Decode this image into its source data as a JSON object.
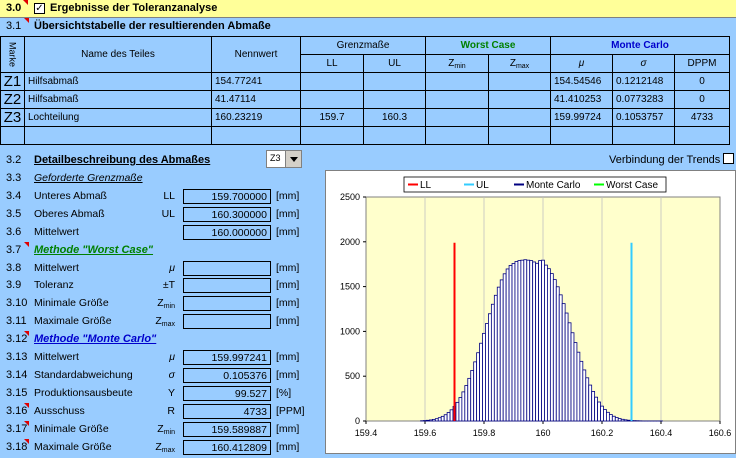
{
  "header": {
    "section_no": "3.0",
    "title": "Ergebnisse der Toleranzanalyse",
    "checked": "✓"
  },
  "overview": {
    "row_no": "3.1",
    "title": "Übersichtstabelle der resultierenden Abmaße"
  },
  "table": {
    "marker_header": "Marke",
    "name_header": "Name des Teiles",
    "nominal_header": "Nennwert",
    "limits_header": "Grenzmaße",
    "ll": "LL",
    "ul": "UL",
    "wc_header": "Worst Case",
    "zmin": "Z",
    "zmin_sub": "min",
    "zmax": "Z",
    "zmax_sub": "max",
    "mc_header": "Monte Carlo",
    "mu": "μ",
    "sigma": "σ",
    "dppm": "DPPM",
    "rows": [
      {
        "mark": "Z1",
        "name": "Hilfsabmaß",
        "nominal": "154.77241",
        "ll": "",
        "ul": "",
        "zmin": "",
        "zmax": "",
        "mu": "154.54546",
        "sigma": "0.1212148",
        "dppm": "0"
      },
      {
        "mark": "Z2",
        "name": "Hilfsabmaß",
        "nominal": "41.47114",
        "ll": "",
        "ul": "",
        "zmin": "",
        "zmax": "",
        "mu": "41.410253",
        "sigma": "0.0773283",
        "dppm": "0"
      },
      {
        "mark": "Z3",
        "name": "Lochteilung",
        "nominal": "160.23219",
        "ll": "159.7",
        "ul": "160.3",
        "zmin": "",
        "zmax": "",
        "mu": "159.99724",
        "sigma": "0.1053757",
        "dppm": "4733"
      }
    ]
  },
  "detail": {
    "row_no": "3.2",
    "title": "Detailbeschreibung des Abmaßes",
    "selector": "Z3",
    "trend_label": "Verbindung der Trends",
    "rows": [
      {
        "no": "3.3",
        "label": "Geforderte Grenzmaße",
        "type": "section"
      },
      {
        "no": "3.4",
        "label": "Unteres Abmaß",
        "sym": "LL",
        "value": "159.700000",
        "unit": "[mm]"
      },
      {
        "no": "3.5",
        "label": "Oberes Abmaß",
        "sym": "UL",
        "value": "160.300000",
        "unit": "[mm]"
      },
      {
        "no": "3.6",
        "label": "Mittelwert",
        "sym": "",
        "value": "160.000000",
        "unit": "[mm]"
      },
      {
        "no": "3.7",
        "label": "Methode \"Worst Case\"",
        "type": "wc"
      },
      {
        "no": "3.8",
        "label": "Mittelwert",
        "sym": "μ",
        "value": "",
        "unit": "[mm]"
      },
      {
        "no": "3.9",
        "label": "Toleranz",
        "sym": "±T",
        "value": "",
        "unit": "[mm]"
      },
      {
        "no": "3.10",
        "label": "Minimale Größe",
        "sym": "Z",
        "symsub": "min",
        "value": "",
        "unit": "[mm]"
      },
      {
        "no": "3.11",
        "label": "Maximale Größe",
        "sym": "Z",
        "symsub": "max",
        "value": "",
        "unit": "[mm]"
      },
      {
        "no": "3.12",
        "label": "Methode \"Monte Carlo\"",
        "type": "mc"
      },
      {
        "no": "3.13",
        "label": "Mittelwert",
        "sym": "μ",
        "value": "159.997241",
        "unit": "[mm]"
      },
      {
        "no": "3.14",
        "label": "Standardabweichung",
        "sym": "σ",
        "value": "0.105376",
        "unit": "[mm]"
      },
      {
        "no": "3.15",
        "label": "Produktionsausbeute",
        "sym": "Y",
        "value": "99.527",
        "unit": "[%]"
      },
      {
        "no": "3.16",
        "label": "Ausschuss",
        "sym": "R",
        "value": "4733",
        "unit": "[PPM]"
      },
      {
        "no": "3.17",
        "label": "Minimale Größe",
        "sym": "Z",
        "symsub": "min",
        "value": "159.589887",
        "unit": "[mm]"
      },
      {
        "no": "3.18",
        "label": "Maximale Größe",
        "sym": "Z",
        "symsub": "max",
        "value": "160.412809",
        "unit": "[mm]"
      }
    ]
  },
  "chart_data": {
    "type": "bar",
    "legend": [
      "LL",
      "UL",
      "Monte Carlo",
      "Worst Case"
    ],
    "legend_colors": [
      "#ff0000",
      "#33ccff",
      "#000080",
      "#00ff00"
    ],
    "xlim": [
      159.4,
      160.6
    ],
    "ylim": [
      0,
      2500
    ],
    "xticks": [
      159.4,
      159.6,
      159.8,
      160,
      160.2,
      160.4,
      160.6
    ],
    "yticks": [
      0,
      500,
      1000,
      1500,
      2000,
      2500
    ],
    "ll": 159.7,
    "ul": 160.3,
    "limit_line_height": 1990,
    "bin_width": 0.01,
    "bins": [
      {
        "x": 159.59,
        "y": 3
      },
      {
        "x": 159.6,
        "y": 5
      },
      {
        "x": 159.61,
        "y": 8
      },
      {
        "x": 159.62,
        "y": 12
      },
      {
        "x": 159.63,
        "y": 18
      },
      {
        "x": 159.64,
        "y": 26
      },
      {
        "x": 159.65,
        "y": 37
      },
      {
        "x": 159.66,
        "y": 52
      },
      {
        "x": 159.67,
        "y": 70
      },
      {
        "x": 159.68,
        "y": 95
      },
      {
        "x": 159.69,
        "y": 125
      },
      {
        "x": 159.7,
        "y": 163
      },
      {
        "x": 159.71,
        "y": 208
      },
      {
        "x": 159.72,
        "y": 262
      },
      {
        "x": 159.73,
        "y": 325
      },
      {
        "x": 159.74,
        "y": 396
      },
      {
        "x": 159.75,
        "y": 476
      },
      {
        "x": 159.76,
        "y": 564
      },
      {
        "x": 159.77,
        "y": 660
      },
      {
        "x": 159.78,
        "y": 762
      },
      {
        "x": 159.79,
        "y": 868
      },
      {
        "x": 159.8,
        "y": 978
      },
      {
        "x": 159.81,
        "y": 1088
      },
      {
        "x": 159.82,
        "y": 1197
      },
      {
        "x": 159.83,
        "y": 1303
      },
      {
        "x": 159.84,
        "y": 1403
      },
      {
        "x": 159.85,
        "y": 1494
      },
      {
        "x": 159.86,
        "y": 1575
      },
      {
        "x": 159.87,
        "y": 1643
      },
      {
        "x": 159.88,
        "y": 1697
      },
      {
        "x": 159.89,
        "y": 1736
      },
      {
        "x": 159.9,
        "y": 1758
      },
      {
        "x": 159.91,
        "y": 1780
      },
      {
        "x": 159.92,
        "y": 1790
      },
      {
        "x": 159.93,
        "y": 1795
      },
      {
        "x": 159.94,
        "y": 1800
      },
      {
        "x": 159.95,
        "y": 1795
      },
      {
        "x": 159.96,
        "y": 1790
      },
      {
        "x": 159.97,
        "y": 1775
      },
      {
        "x": 159.98,
        "y": 1760
      },
      {
        "x": 159.99,
        "y": 1790
      },
      {
        "x": 160.0,
        "y": 1795
      },
      {
        "x": 160.01,
        "y": 1740
      },
      {
        "x": 160.02,
        "y": 1700
      },
      {
        "x": 160.03,
        "y": 1645
      },
      {
        "x": 160.04,
        "y": 1578
      },
      {
        "x": 160.05,
        "y": 1498
      },
      {
        "x": 160.06,
        "y": 1408
      },
      {
        "x": 160.07,
        "y": 1310
      },
      {
        "x": 160.08,
        "y": 1205
      },
      {
        "x": 160.09,
        "y": 1096
      },
      {
        "x": 160.1,
        "y": 985
      },
      {
        "x": 160.11,
        "y": 875
      },
      {
        "x": 160.12,
        "y": 768
      },
      {
        "x": 160.13,
        "y": 666
      },
      {
        "x": 160.14,
        "y": 570
      },
      {
        "x": 160.15,
        "y": 482
      },
      {
        "x": 160.16,
        "y": 401
      },
      {
        "x": 160.17,
        "y": 330
      },
      {
        "x": 160.18,
        "y": 266
      },
      {
        "x": 160.19,
        "y": 212
      },
      {
        "x": 160.2,
        "y": 166
      },
      {
        "x": 160.21,
        "y": 128
      },
      {
        "x": 160.22,
        "y": 97
      },
      {
        "x": 160.23,
        "y": 72
      },
      {
        "x": 160.24,
        "y": 53
      },
      {
        "x": 160.25,
        "y": 38
      },
      {
        "x": 160.26,
        "y": 27
      },
      {
        "x": 160.27,
        "y": 19
      },
      {
        "x": 160.28,
        "y": 13
      },
      {
        "x": 160.29,
        "y": 9
      },
      {
        "x": 160.3,
        "y": 6
      },
      {
        "x": 160.31,
        "y": 4
      },
      {
        "x": 160.32,
        "y": 3
      },
      {
        "x": 160.33,
        "y": 2
      },
      {
        "x": 160.34,
        "y": 1
      },
      {
        "x": 160.35,
        "y": 1
      },
      {
        "x": 160.36,
        "y": 1
      },
      {
        "x": 160.37,
        "y": 1
      },
      {
        "x": 160.38,
        "y": 1
      },
      {
        "x": 160.39,
        "y": 1
      },
      {
        "x": 160.4,
        "y": 1
      }
    ]
  }
}
